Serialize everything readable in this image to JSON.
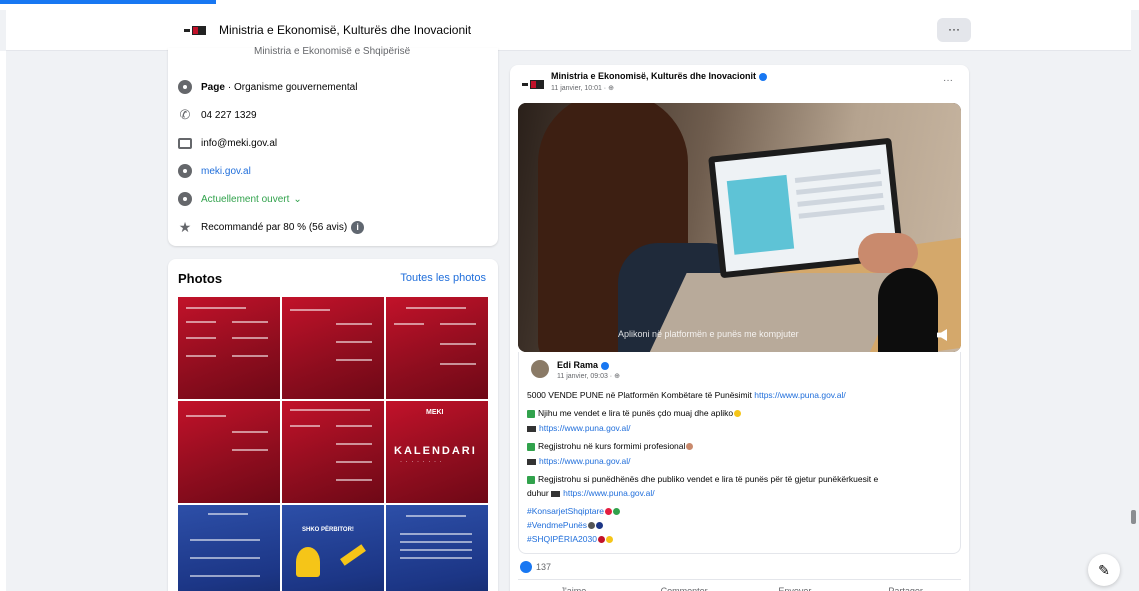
{
  "header": {
    "title": "Ministria e Ekonomisë, Kulturës dhe Inovacionit",
    "more": "···"
  },
  "intro": {
    "cut_text": "Ministria e Ekonomisë e Shqipërisë",
    "type_label": "Page",
    "type_value": " · Organisme gouvernemental",
    "phone": "04 227 1329",
    "email": "info@meki.gov.al",
    "website": "meki.gov.al",
    "hours": "Actuellement ouvert",
    "hours_chevron": "⌄",
    "recommend": "Recommandé par 80 % (56 avis)",
    "recommend_info": "i"
  },
  "photos": {
    "title": "Photos",
    "all_link": "Toutes les photos",
    "tile_calendar": "KALENDARI",
    "tile_calendar_sub": "· · · · · · · ·",
    "tile_brand": "MEKI",
    "tile_blue_text": "SHKO PËRBITOR!"
  },
  "post": {
    "page_name": "Ministria e Ekonomisë, Kulturës dhe Inovacionit",
    "date": "11 janvier, 10:01 · ",
    "more": "···",
    "video_caption": "Aplikoni në platformën e punës me kompjuter",
    "shared": {
      "author": "Edi Rama",
      "date": "11 janvier, 09:03 · ",
      "line1_text": "5000 VENDE PUNE në Platformën Kombëtare të Punësimit ",
      "line1_link": "https://www.puna.gov.al/",
      "line2_text": "Njihu me vendet e lira të punës çdo muaj dhe apliko",
      "line3_link": "https://www.puna.gov.al/",
      "line4_text": "Regjistrohu në kurs formimi profesional",
      "line5_link": "https://www.puna.gov.al/",
      "line6_text": "Regjistrohu si punëdhënës dhe publiko vendet e lira të punës për të gjetur punëkërkuesit e",
      "line7_text": "duhur ",
      "line7_link": "https://www.puna.gov.al/",
      "tag1": "#KonsarjetShqiptare",
      "tag2": "#VendmePunës",
      "tag3": "#SHQIPËRIA2030"
    },
    "likes_count": "137",
    "actions": [
      "J'aime",
      "Commenter",
      "Envoyer",
      "Partager"
    ]
  },
  "fab_icon": "compose-icon",
  "colors": {
    "accent": "#1877f2",
    "red_tile": "#c2122a",
    "blue_tile": "#2d4fa8"
  }
}
